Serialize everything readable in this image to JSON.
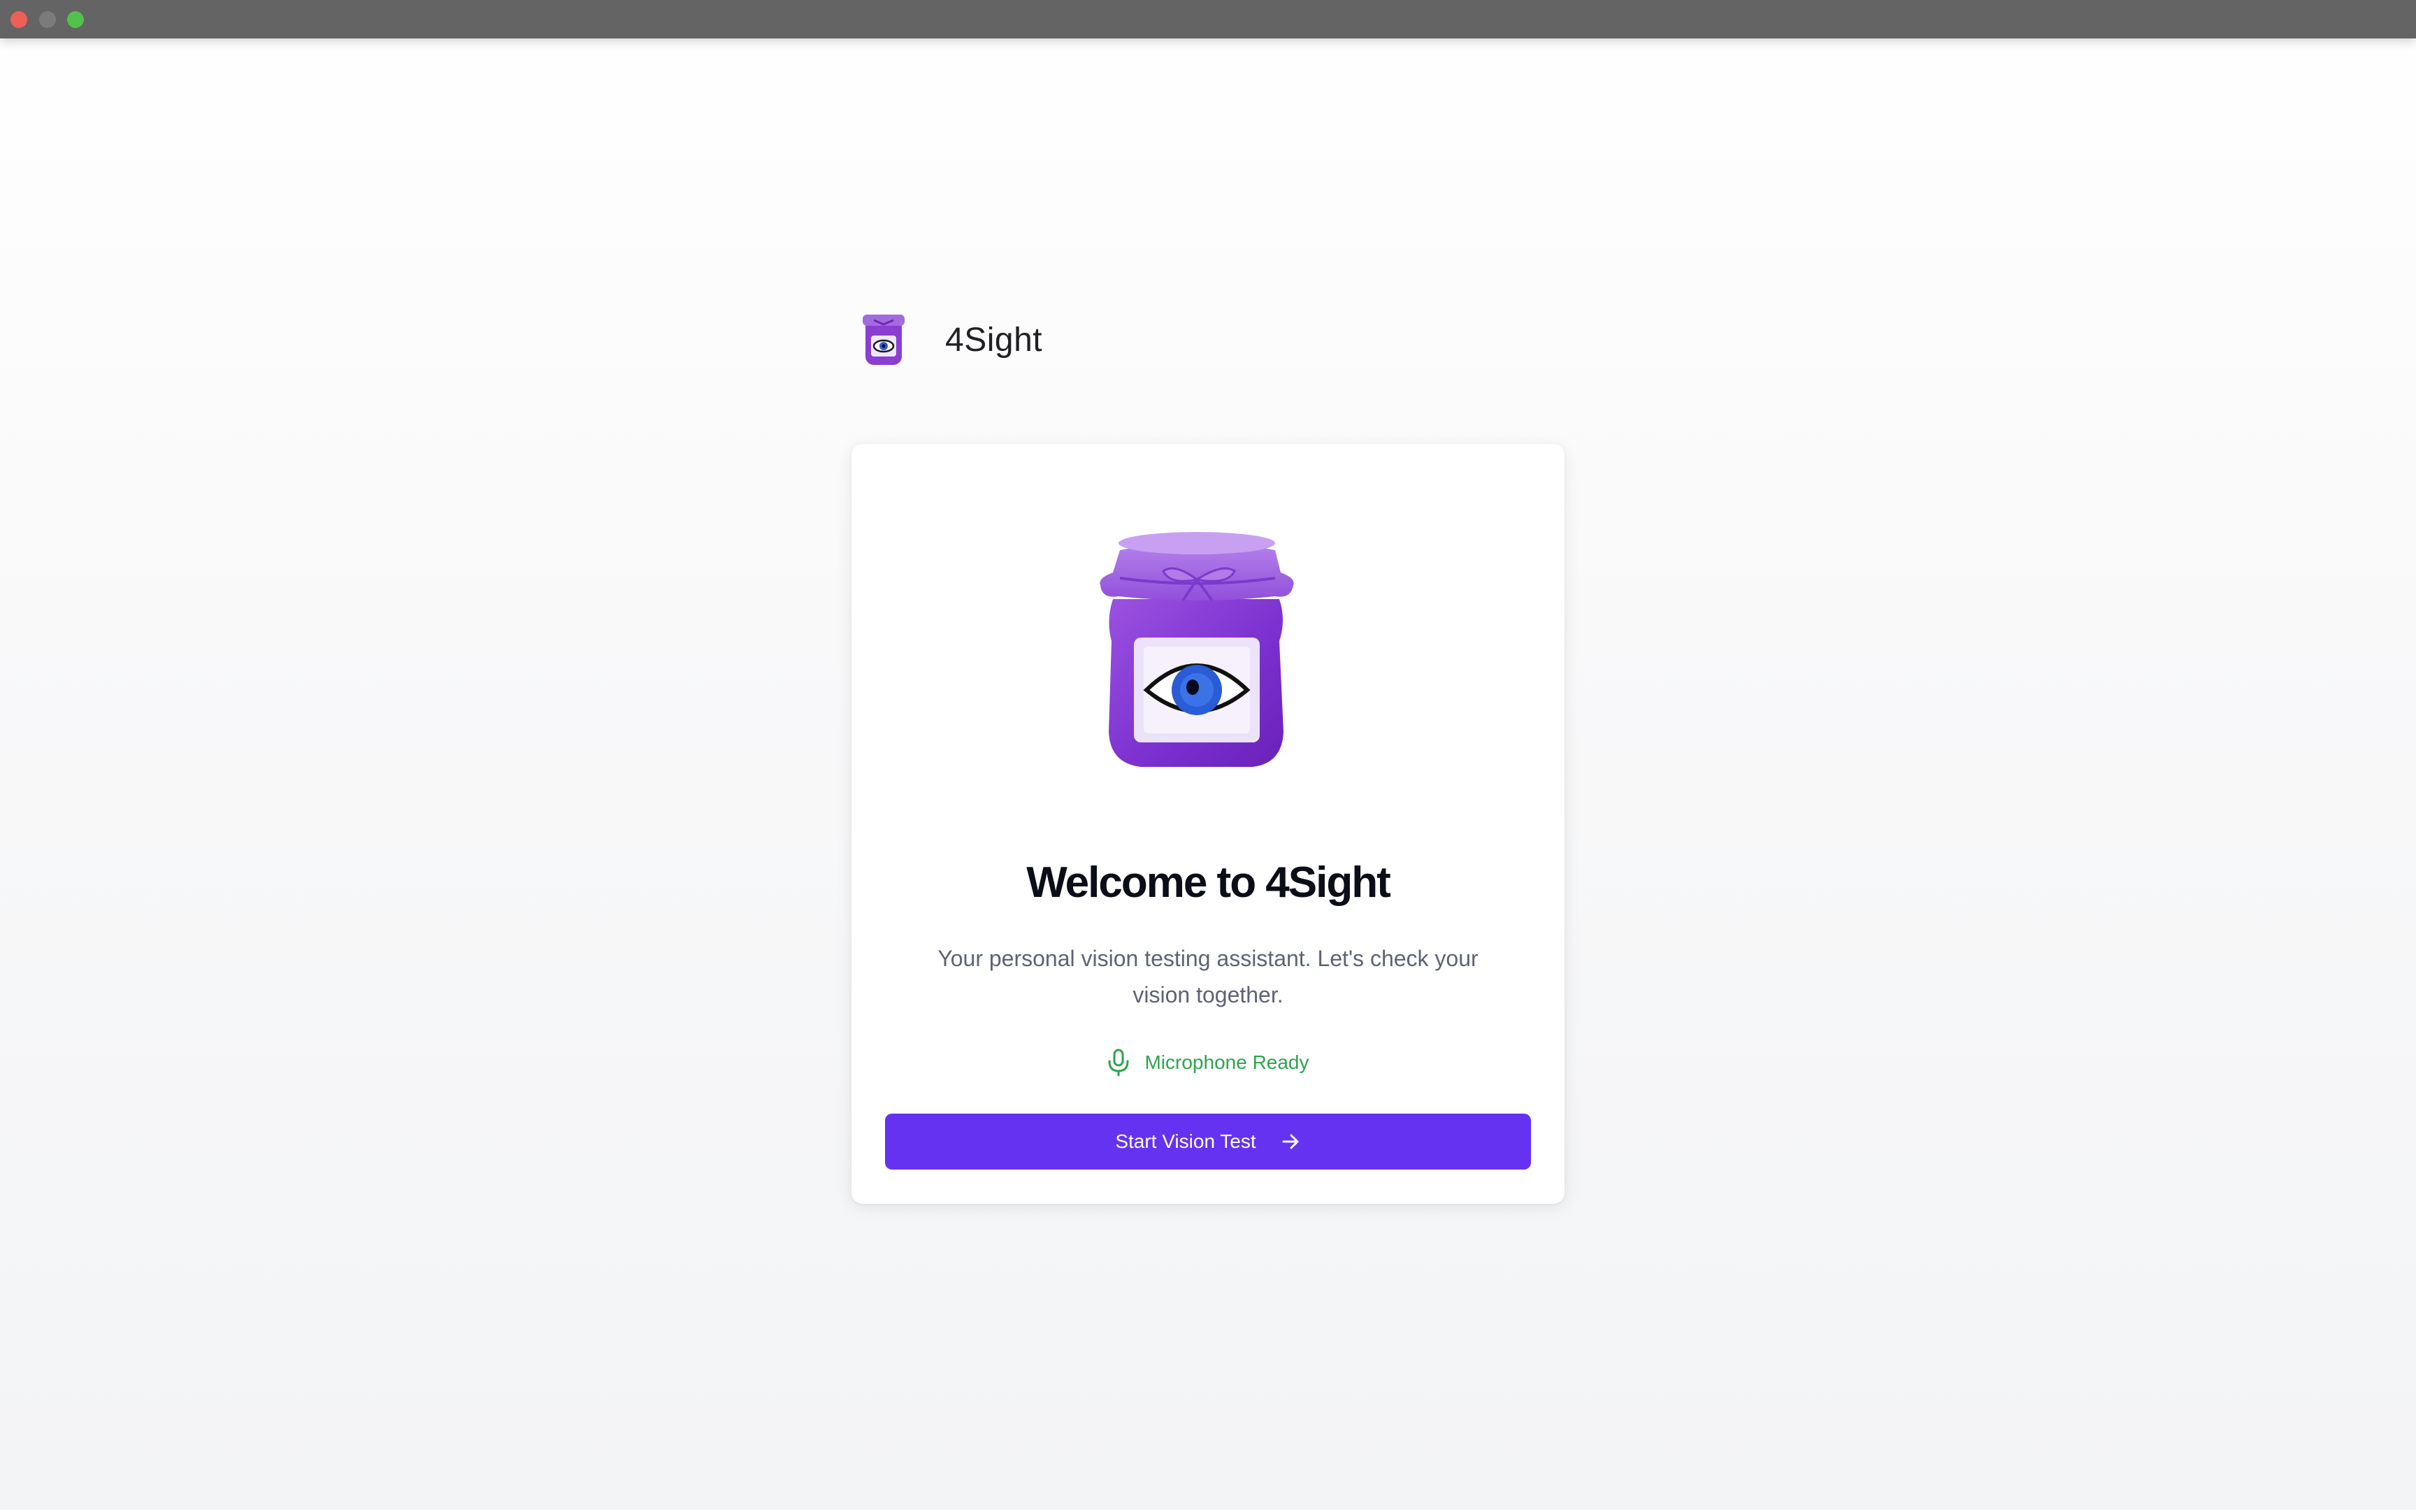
{
  "app": {
    "name": "4Sight"
  },
  "window": {
    "controls": [
      "close-icon",
      "minimize-icon",
      "maximize-icon"
    ]
  },
  "welcome": {
    "title": "Welcome to 4Sight",
    "subtitle": "Your personal vision testing assistant. Let's check your vision together.",
    "mic_status": "Microphone Ready",
    "mic_icon": "microphone-icon",
    "start_button": "Start Vision Test",
    "start_icon": "arrow-right-icon"
  },
  "colors": {
    "accent": "#6432f0",
    "status_ok": "#2ea44f",
    "jar": "#8a3fd0",
    "eye": "#2a5cd6"
  }
}
